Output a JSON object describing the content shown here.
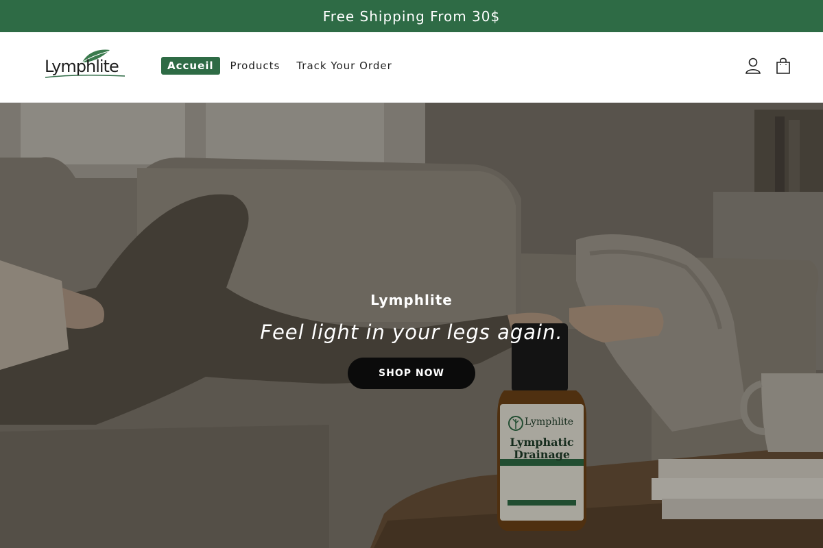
{
  "announcement": {
    "text": "Free Shipping From 30$"
  },
  "header": {
    "logo_text": "Lymphlite",
    "nav": [
      {
        "label": "Accueil",
        "active": true
      },
      {
        "label": "Products",
        "active": false
      },
      {
        "label": "Track Your Order",
        "active": false
      }
    ],
    "icons": [
      "account-icon",
      "cart-icon"
    ]
  },
  "hero": {
    "brand": "Lymphlite",
    "tagline": "Feel light in your legs again.",
    "button_label": "SHOP NOW",
    "bottle": {
      "brand": "Lymphlite",
      "product_line1": "Lymphatic",
      "product_line2": "Drainage"
    }
  },
  "colors": {
    "brand_green": "#2e6b45",
    "button_black": "#0b0b0b"
  }
}
